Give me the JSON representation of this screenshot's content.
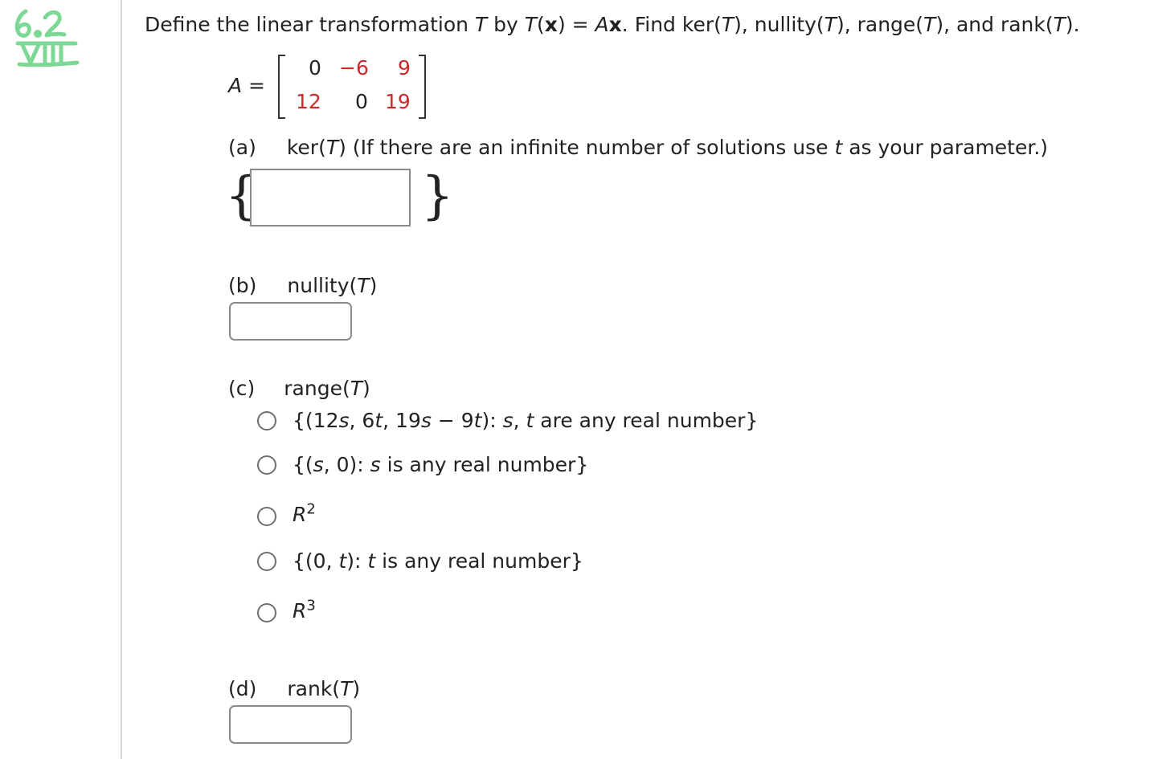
{
  "margin_note": {
    "line1": "6.2",
    "line2": "VIII"
  },
  "question": {
    "p1": "Define the linear transformation ",
    "T1": "T",
    "p2": " by ",
    "T2": "T",
    "p3": "(",
    "x1": "x",
    "p4": ") = ",
    "A": "A",
    "x2": "x",
    "p5": ". Find ker(",
    "T3": "T",
    "p6": "), nullity(",
    "T4": "T",
    "p7": "), range(",
    "T5": "T",
    "p8": "), and rank(",
    "T6": "T",
    "p9": ")."
  },
  "matrix": {
    "label_var": "A",
    "label_eq": " =",
    "rows": [
      [
        "0",
        "−6",
        "9"
      ],
      [
        "12",
        "0",
        "19"
      ]
    ],
    "highlight_color": "#cc2a2a",
    "normal_color": "#222222"
  },
  "part_a": {
    "letter": "(a)",
    "t1": "ker(",
    "T": "T",
    "t2": ") (If there are an infinite number of solutions use ",
    "t": "t",
    "t3": " as your parameter.)",
    "brace_open": "{",
    "brace_close": "}",
    "answer": ""
  },
  "part_b": {
    "letter": "(b)",
    "t1": "nullity(",
    "T": "T",
    "t2": ")",
    "answer": ""
  },
  "part_c": {
    "letter": "(c)",
    "t1": "range(",
    "T": "T",
    "t2": ")",
    "options": [
      {
        "a": "{(12",
        "s1": "s",
        "b": ", 6",
        "t1": "t",
        "c": ", 19",
        "s2": "s",
        "d": " − 9",
        "t2": "t",
        "e": "): ",
        "s3": "s",
        "f": ", ",
        "t3": "t",
        "g": " are any real number}"
      },
      {
        "a": "{(",
        "s1": "s",
        "b": ", 0): ",
        "s2": "s",
        "c": " is any real number}"
      },
      {
        "R": "R",
        "exp": "2"
      },
      {
        "a": "{(0, ",
        "t1": "t",
        "b": "): ",
        "t2": "t",
        "c": " is any real number}"
      },
      {
        "R": "R",
        "exp": "3"
      }
    ]
  },
  "part_d": {
    "letter": "(d)",
    "t1": "rank(",
    "T": "T",
    "t2": ")",
    "answer": ""
  }
}
